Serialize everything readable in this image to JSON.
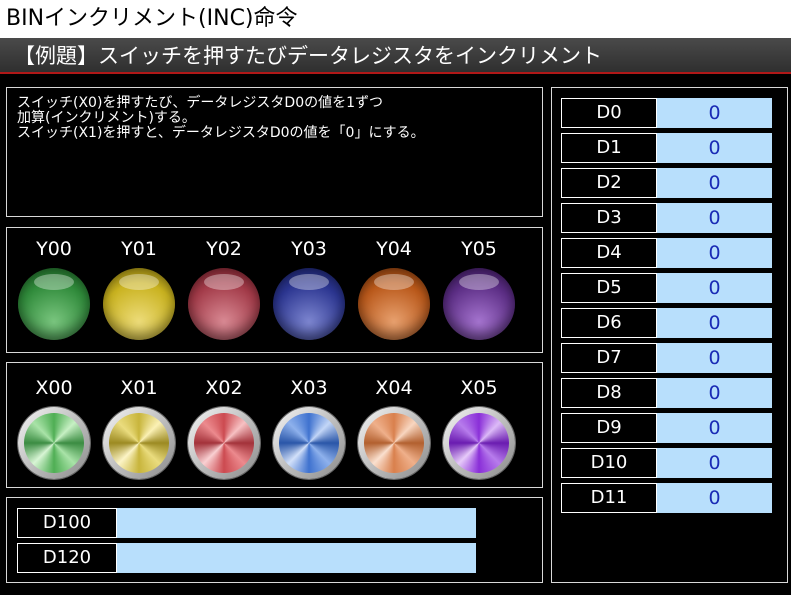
{
  "window_title": "BINインクリメント(INC)命令",
  "subtitle": "【例題】スイッチを押すたびデータレジスタをインクリメント",
  "description": [
    "スイッチ(X0)を押すたび、データレジスタD0の値を1ずつ",
    "加算(インクリメント)する。",
    "スイッチ(X1)を押すと、データレジスタD0の値を「0」にする。"
  ],
  "lamps": [
    {
      "label": "Y00",
      "color": "#2f8a3a",
      "icon": "green-lamp-icon"
    },
    {
      "label": "Y01",
      "color": "#c9b21f",
      "icon": "yellow-lamp-icon"
    },
    {
      "label": "Y02",
      "color": "#a23a48",
      "icon": "red-lamp-icon"
    },
    {
      "label": "Y03",
      "color": "#2b3590",
      "icon": "blue-lamp-icon"
    },
    {
      "label": "Y04",
      "color": "#b9581a",
      "icon": "orange-lamp-icon"
    },
    {
      "label": "Y05",
      "color": "#5b2d84",
      "icon": "purple-lamp-icon"
    }
  ],
  "switches": [
    {
      "label": "X00",
      "color": "#5fbe5f",
      "icon": "green-switch-icon"
    },
    {
      "label": "X01",
      "color": "#d6c24a",
      "icon": "yellow-switch-icon"
    },
    {
      "label": "X02",
      "color": "#d4555a",
      "icon": "red-switch-icon"
    },
    {
      "label": "X03",
      "color": "#4a7fd6",
      "icon": "blue-switch-icon"
    },
    {
      "label": "X04",
      "color": "#e08a5a",
      "icon": "orange-switch-icon"
    },
    {
      "label": "X05",
      "color": "#9a3de0",
      "icon": "purple-switch-icon"
    }
  ],
  "big_registers": [
    {
      "name": "D100",
      "value": ""
    },
    {
      "name": "D120",
      "value": ""
    }
  ],
  "registers": [
    {
      "name": "D0",
      "value": "0"
    },
    {
      "name": "D1",
      "value": "0"
    },
    {
      "name": "D2",
      "value": "0"
    },
    {
      "name": "D3",
      "value": "0"
    },
    {
      "name": "D4",
      "value": "0"
    },
    {
      "name": "D5",
      "value": "0"
    },
    {
      "name": "D6",
      "value": "0"
    },
    {
      "name": "D7",
      "value": "0"
    },
    {
      "name": "D8",
      "value": "0"
    },
    {
      "name": "D9",
      "value": "0"
    },
    {
      "name": "D10",
      "value": "0"
    },
    {
      "name": "D11",
      "value": "0"
    }
  ]
}
